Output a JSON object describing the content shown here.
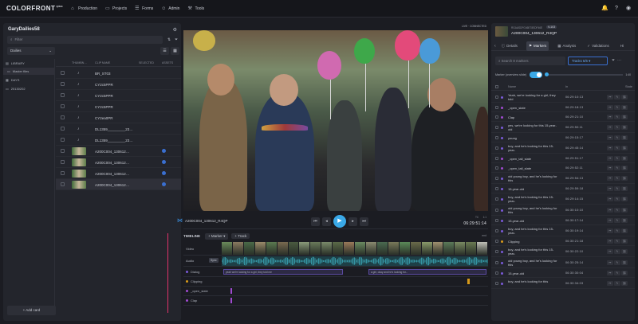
{
  "app": {
    "logo": "COLORFRONT",
    "logo_sup": "QWE"
  },
  "nav": [
    {
      "label": "Production",
      "icon": "home-icon"
    },
    {
      "label": "Projects",
      "icon": "folder-icon"
    },
    {
      "label": "Forms",
      "icon": "list-icon"
    },
    {
      "label": "Admin",
      "icon": "user-icon"
    },
    {
      "label": "Tools",
      "icon": "wrench-icon"
    }
  ],
  "left": {
    "title": "GaryDailies58",
    "filter_placeholder": "Filter",
    "dropdown": "Dailies",
    "tree": [
      "LIBRARY",
      "Master files",
      "DAYS",
      "20130202"
    ],
    "columns": [
      "THUMBN…",
      "CLIP NAME",
      "SELECTED",
      "ASSETS"
    ],
    "rows": [
      {
        "name": "BR_ST03",
        "type": "audio"
      },
      {
        "name": "CY2c5PPR",
        "type": "audio"
      },
      {
        "name": "CY2c5PPR",
        "type": "audio"
      },
      {
        "name": "CY2c5PPR",
        "type": "audio"
      },
      {
        "name": "CY2ea0PR",
        "type": "audio"
      },
      {
        "name": "DL1359_________23…",
        "type": "audio"
      },
      {
        "name": "DL1359_________23…",
        "type": "audio"
      },
      {
        "name": "A200C004_130612…",
        "type": "video"
      },
      {
        "name": "A200C004_130612…",
        "type": "video"
      },
      {
        "name": "A200C004_130612…",
        "type": "video"
      },
      {
        "name": "A200C004_130612…",
        "type": "video"
      }
    ],
    "add_card": "+ Add card"
  },
  "viewer": {
    "badge": "LIVE · CONNECTED"
  },
  "transport": {
    "clip": "A200C004_130612_R4QP",
    "tc_label": "TC",
    "timecode": "06:29:51:14",
    "ratio_label": "1:1"
  },
  "timeline": {
    "label": "TIMELINE",
    "marker_btn": "+ Marker ▾",
    "track_btn": "+ Track",
    "ruler_end": "end",
    "tracks": [
      {
        "name": "Video"
      },
      {
        "name": "Audio",
        "badge": "Sync"
      },
      {
        "name": "Dialog",
        "text1": "yeah we're looking for a girl, they told me",
        "text2": "a girl, okay and he's looking for...",
        "color": "#7a5ad8"
      },
      {
        "name": "Clipping",
        "color": "#d89a1a"
      },
      {
        "name": "_open_slate",
        "color": "#a04ad0"
      },
      {
        "name": "Clap",
        "color": "#a04ad0"
      }
    ]
  },
  "right": {
    "sub": "RGAASDFG46E78SDF46E",
    "badge": "V-103",
    "title": "A200C004_130612_R4QP",
    "tabs": [
      "Details",
      "Markers",
      "Analysis",
      "Validations",
      "Hi"
    ],
    "search_placeholder": "Search 8 markers",
    "tracks_btn": "Tracks 6/6 ▾",
    "marker_toggle_label": "Marker (overview slide)",
    "ratio": "1:40",
    "columns": [
      "Name",
      "In",
      "State"
    ],
    "markers": [
      {
        "name": "Yeah, we're looking for a girl, they told",
        "in": "06:29:10:13",
        "color": "#7a5ad8",
        "lines": 2
      },
      {
        "name": "_open_slate",
        "in": "06:29:18:13",
        "color": "#a04ad0",
        "lines": 1
      },
      {
        "name": "Clap",
        "in": "06:29:21:10",
        "color": "#a04ad0",
        "lines": 1
      },
      {
        "name": "yes, we're looking for this 15-year-old",
        "in": "06:29:50:11",
        "color": "#7a5ad8",
        "lines": 2
      },
      {
        "name": "young",
        "in": "06:29:15:17",
        "color": "#7a5ad8",
        "lines": 1
      },
      {
        "name": "boy, and he's looking for this 15-year-",
        "in": "06:29:45:14",
        "color": "#7a5ad8",
        "lines": 2
      },
      {
        "name": "_open_tail_slate",
        "in": "06:29:51:17",
        "color": "#a04ad0",
        "lines": 1
      },
      {
        "name": "_open_tail_slate",
        "in": "06:29:52:11",
        "color": "#a04ad0",
        "lines": 1
      },
      {
        "name": "old young boy, and he's looking for this",
        "in": "06:29:54:13",
        "color": "#7a5ad8",
        "lines": 2
      },
      {
        "name": "15-year-old",
        "in": "06:29:59:18",
        "color": "#7a5ad8",
        "lines": 1
      },
      {
        "name": "boy, and he's looking for this 15-year-",
        "in": "06:29:14:15",
        "color": "#7a5ad8",
        "lines": 2
      },
      {
        "name": "old young boy, and he's looking for this",
        "in": "06:30:10:10",
        "color": "#7a5ad8",
        "lines": 2
      },
      {
        "name": "15-year-old",
        "in": "06:30:17:14",
        "color": "#7a5ad8",
        "lines": 1
      },
      {
        "name": "boy, and he's looking for this 15-year-",
        "in": "06:30:19:14",
        "color": "#7a5ad8",
        "lines": 2
      },
      {
        "name": "Clipping",
        "in": "06:30:21:18",
        "color": "#d89a1a",
        "lines": 1
      },
      {
        "name": "boy, and he's looking for this 15-year-",
        "in": "06:30:22:10",
        "color": "#7a5ad8",
        "lines": 2
      },
      {
        "name": "old young boy, and he's looking for this",
        "in": "06:30:25:14",
        "color": "#7a5ad8",
        "lines": 2
      },
      {
        "name": "15-year-old",
        "in": "06:30:30:04",
        "color": "#7a5ad8",
        "lines": 1
      },
      {
        "name": "boy, and he's looking for this",
        "in": "06:30:34:03",
        "color": "#7a5ad8",
        "lines": 2
      }
    ]
  }
}
